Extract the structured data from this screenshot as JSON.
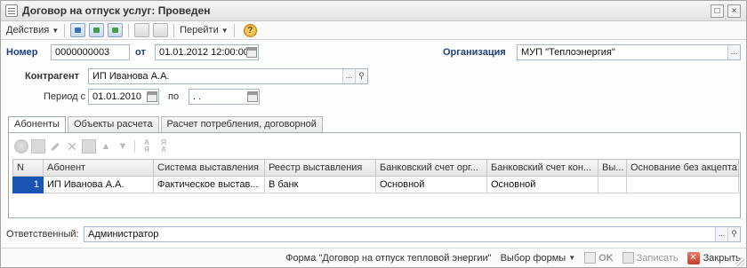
{
  "window": {
    "title": "Договор на отпуск услуг: Проведен"
  },
  "toolbar": {
    "actions_label": "Действия",
    "goto_label": "Перейти"
  },
  "header": {
    "number_label": "Номер",
    "number_value": "0000000003",
    "date_label": "от",
    "date_value": "01.01.2012 12:00:00",
    "org_label": "Организация",
    "org_value": "МУП \"Теплоэнергия\""
  },
  "counterparty": {
    "label": "Контрагент",
    "value": "ИП Иванова А.А.",
    "ellipsis": "..."
  },
  "period": {
    "label": "Период с",
    "from_value": "01.01.2010",
    "to_label": "по",
    "to_value": " .  ."
  },
  "tabs": [
    {
      "label": "Абоненты",
      "active": true
    },
    {
      "label": "Объекты расчета",
      "active": false
    },
    {
      "label": "Расчет потребления, договорной",
      "active": false
    }
  ],
  "table": {
    "columns": [
      "N",
      "Абонент",
      "Система выставления",
      "Реестр выставления",
      "Банковский счет орг...",
      "Банковский счет кон...",
      "Вы...",
      "Основание без акцепта"
    ],
    "rows": [
      [
        "1",
        "ИП Иванова А.А.",
        "Фактическое выстав...",
        "В банк",
        "Основной",
        "Основной",
        "",
        ""
      ]
    ]
  },
  "responsible": {
    "label": "Ответственный:",
    "value": "Администратор"
  },
  "statusbar": {
    "form_label": "Форма \"Договор на отпуск тепловой энергии\"",
    "choose_form_label": "Выбор формы",
    "ok_label": "OK",
    "save_label": "Записать",
    "close_label": "Закрыть"
  },
  "icons": {
    "help": "?",
    "close_window": "×",
    "maximize": "□"
  }
}
